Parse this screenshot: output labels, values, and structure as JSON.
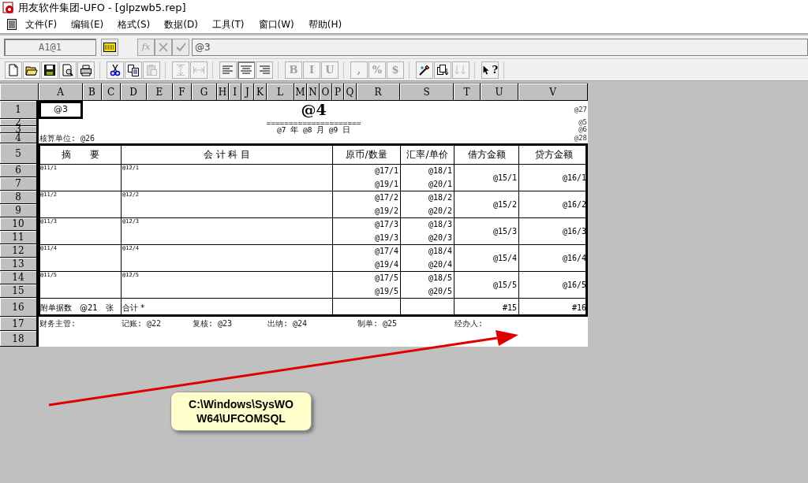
{
  "window": {
    "title": "用友软件集团-UFO - [glpzwb5.rep]"
  },
  "menu": [
    "文件(F)",
    "编辑(E)",
    "格式(S)",
    "数据(D)",
    "工具(T)",
    "窗口(W)",
    "帮助(H)"
  ],
  "formula_bar": {
    "cell_ref": "A1@1",
    "content": "@3",
    "buttons": [
      {
        "label": "fx",
        "disabled": true
      },
      {
        "disabled": true
      },
      {
        "disabled": true
      }
    ]
  },
  "toolbar": [
    [
      {
        "disabled": false
      },
      {
        "disabled": false
      },
      {
        "disabled": false
      },
      {
        "disabled": false
      },
      {
        "disabled": false
      }
    ],
    [
      {
        "disabled": false
      },
      {
        "disabled": false
      },
      {
        "disabled": true
      }
    ],
    [
      {
        "disabled": true
      },
      {
        "disabled": true
      }
    ],
    [
      {
        "disabled": false,
        "selected": false
      },
      {
        "disabled": false,
        "selected": true
      },
      {
        "disabled": false,
        "selected": false
      }
    ],
    [
      {
        "label": "B",
        "disabled": true
      },
      {
        "label": "I",
        "disabled": true
      },
      {
        "label": "U",
        "disabled": true
      }
    ],
    [
      {
        "label": ",",
        "disabled": true
      },
      {
        "label": "%",
        "disabled": true
      },
      {
        "label": "$",
        "disabled": true
      }
    ],
    [
      {
        "disabled": false
      },
      {
        "disabled": false
      },
      {
        "disabled": true
      }
    ],
    [
      {
        "label": "?",
        "disabled": false
      }
    ]
  ],
  "sheet": {
    "columns": [
      "A",
      "B",
      "C",
      "D",
      "E",
      "F",
      "G",
      "H",
      "I",
      "J",
      "K",
      "L",
      "M",
      "N",
      "O",
      "P",
      "Q",
      "R",
      "S",
      "T",
      "U",
      "V"
    ],
    "rows": [
      "1",
      "2",
      "3",
      "4",
      "5",
      "6",
      "7",
      "8",
      "9",
      "10",
      "11",
      "12",
      "13",
      "14",
      "15",
      "16",
      "17",
      "18"
    ],
    "cells": [
      {
        "kind": "plain",
        "text": "@3",
        "selected": true
      },
      {
        "kind": "title",
        "text": "@4",
        "selected": false
      },
      {
        "kind": "margin",
        "text": "@27",
        "selected": false
      },
      {
        "kind": "rule",
        "text": "=====================",
        "selected": false
      },
      {
        "kind": "margin",
        "text": "@5",
        "selected": false
      },
      {
        "kind": "rule",
        "text": "@7 年 @8 月 @9 日",
        "selected": false
      },
      {
        "kind": "margin",
        "text": "@6",
        "selected": false
      },
      {
        "kind": "label",
        "text": "核算单位: @26",
        "selected": false
      },
      {
        "kind": "margin",
        "text": "@28",
        "selected": false
      },
      {
        "kind": "header",
        "text": "摘　　要",
        "selected": false
      },
      {
        "kind": "header",
        "text": "会 计 科 目",
        "selected": false
      },
      {
        "kind": "header",
        "text": "原币/数量",
        "selected": false
      },
      {
        "kind": "header",
        "text": "汇率/单价",
        "selected": false
      },
      {
        "kind": "header",
        "text": "借方金额",
        "selected": false
      },
      {
        "kind": "header",
        "text": "贷方金额",
        "selected": false
      },
      {
        "kind": "tiny",
        "text": "@11/1",
        "selected": false
      },
      {
        "kind": "tiny",
        "text": "@12/1",
        "selected": false
      },
      {
        "kind": "amount",
        "text": "@17/1",
        "selected": false
      },
      {
        "kind": "amount",
        "text": "@18/1",
        "selected": false
      },
      {
        "kind": "lower",
        "text": "@19/1",
        "selected": false
      },
      {
        "kind": "lower",
        "text": "@20/1",
        "selected": false
      },
      {
        "kind": "amount",
        "text": "@15/1",
        "selected": false
      },
      {
        "kind": "amount",
        "text": "@16/1",
        "selected": false
      },
      {
        "kind": "tiny",
        "text": "@11/2",
        "selected": false
      },
      {
        "kind": "tiny",
        "text": "@12/2",
        "selected": false
      },
      {
        "kind": "amount",
        "text": "@17/2",
        "selected": false
      },
      {
        "kind": "amount",
        "text": "@18/2",
        "selected": false
      },
      {
        "kind": "lower",
        "text": "@19/2",
        "selected": false
      },
      {
        "kind": "lower",
        "text": "@20/2",
        "selected": false
      },
      {
        "kind": "amount",
        "text": "@15/2",
        "selected": false
      },
      {
        "kind": "amount",
        "text": "@16/2",
        "selected": false
      },
      {
        "kind": "tiny",
        "text": "@11/3",
        "selected": false
      },
      {
        "kind": "tiny",
        "text": "@12/3",
        "selected": false
      },
      {
        "kind": "amount",
        "text": "@17/3",
        "selected": false
      },
      {
        "kind": "amount",
        "text": "@18/3",
        "selected": false
      },
      {
        "kind": "lower",
        "text": "@19/3",
        "selected": false
      },
      {
        "kind": "lower",
        "text": "@20/3",
        "selected": false
      },
      {
        "kind": "amount",
        "text": "@15/3",
        "selected": false
      },
      {
        "kind": "amount",
        "text": "@16/3",
        "selected": false
      },
      {
        "kind": "tiny",
        "text": "@11/4",
        "selected": false
      },
      {
        "kind": "tiny",
        "text": "@12/4",
        "selected": false
      },
      {
        "kind": "amount",
        "text": "@17/4",
        "selected": false
      },
      {
        "kind": "amount",
        "text": "@18/4",
        "selected": false
      },
      {
        "kind": "lower",
        "text": "@19/4",
        "selected": false
      },
      {
        "kind": "lower",
        "text": "@20/4",
        "selected": false
      },
      {
        "kind": "amount",
        "text": "@15/4",
        "selected": false
      },
      {
        "kind": "amount",
        "text": "@16/4",
        "selected": false
      },
      {
        "kind": "tiny",
        "text": "@11/5",
        "selected": false
      },
      {
        "kind": "tiny",
        "text": "@12/5",
        "selected": false
      },
      {
        "kind": "amount",
        "text": "@17/5",
        "selected": false
      },
      {
        "kind": "amount",
        "text": "@18/5",
        "selected": false
      },
      {
        "kind": "lower",
        "text": "@19/5",
        "selected": false
      },
      {
        "kind": "lower",
        "text": "@20/5",
        "selected": false
      },
      {
        "kind": "amount",
        "text": "@15/5",
        "selected": false
      },
      {
        "kind": "amount",
        "text": "@16/5",
        "selected": false
      },
      {
        "kind": "footer",
        "text": "附单据数　@21　张",
        "selected": false
      },
      {
        "kind": "footer",
        "text": "合计 *",
        "selected": false
      },
      {
        "kind": "empty",
        "selected": false
      },
      {
        "kind": "empty",
        "selected": false
      },
      {
        "kind": "amount",
        "text": "#15",
        "selected": false
      },
      {
        "kind": "amount",
        "text": "#16",
        "selected": false
      },
      {
        "kind": "label",
        "text": "财务主管:",
        "selected": false
      },
      {
        "kind": "label",
        "text": "记账: @22",
        "selected": false
      },
      {
        "kind": "label",
        "text": "复核: @23",
        "selected": false
      },
      {
        "kind": "label",
        "text": "出纳: @24",
        "selected": false
      },
      {
        "kind": "label",
        "text": "制单: @25",
        "selected": false
      },
      {
        "kind": "label",
        "text": "经办人:",
        "selected": false
      }
    ]
  },
  "annotation": {
    "lines": [
      "C:\\Windows\\SysWO",
      "W64\\UFCOMSQL"
    ]
  }
}
